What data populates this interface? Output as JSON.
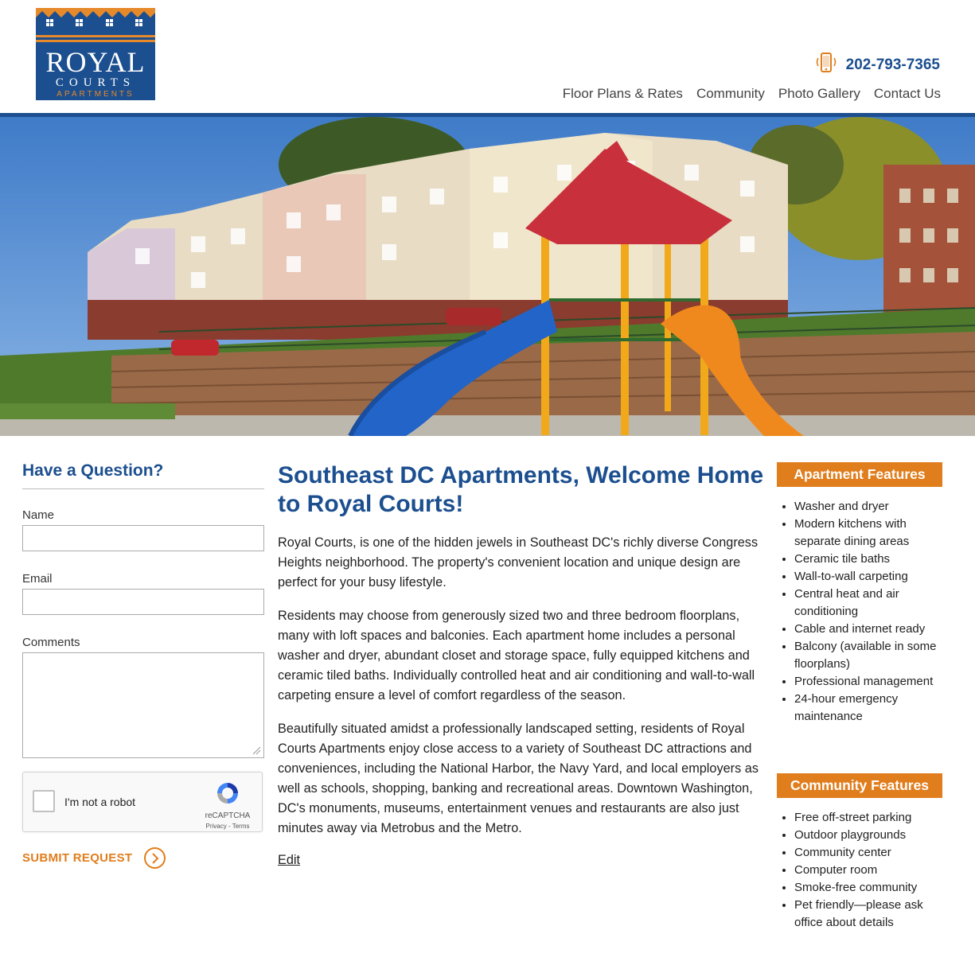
{
  "brand": {
    "line1": "ROYAL",
    "line2": "COURTS",
    "line3": "APARTMENTS",
    "colors": {
      "blue": "#1c4f8f",
      "orange": "#e07d1c"
    }
  },
  "header": {
    "phone_icon": "mobile-phone-icon",
    "phone": "202-793-7365",
    "nav": [
      "Floor Plans & Rates",
      "Community",
      "Photo Gallery",
      "Contact Us"
    ]
  },
  "hero": {
    "slides_total": 3,
    "active_slide": 3
  },
  "form": {
    "title": "Have a Question?",
    "name_label": "Name",
    "email_label": "Email",
    "comments_label": "Comments",
    "captcha_text": "I'm not a robot",
    "captcha_brand": "reCAPTCHA",
    "captcha_terms": "Privacy - Terms",
    "submit_label": "SUBMIT REQUEST"
  },
  "main": {
    "title": "Southeast DC Apartments, Welcome Home to Royal Courts!",
    "paragraphs": [
      "Royal Courts, is one of the hidden jewels in Southeast DC's richly diverse Congress Heights neighborhood. The property's convenient location and unique design are perfect for your busy lifestyle.",
      "Residents may choose from generously sized two and three bedroom floorplans, many with loft spaces and balconies. Each apartment home includes a personal washer and dryer, abundant closet and storage space, fully equipped kitchens and ceramic tiled baths. Individually controlled heat and air conditioning and wall-to-wall carpeting ensure a level of comfort regardless of the season.",
      "Beautifully situated amidst a professionally landscaped setting, residents of Royal Courts Apartments enjoy close access to a variety of Southeast DC attractions and conveniences, including the National Harbor, the Navy Yard, and local employers as well as schools, shopping, banking and recreational areas. Downtown Washington, DC's monuments, museums, entertainment venues and restaurants are also just minutes away via Metrobus and the Metro."
    ],
    "edit_link": "Edit"
  },
  "sidebar": {
    "apartment_title": "Apartment Features",
    "apartment_items": [
      "Washer and dryer",
      "Modern kitchens with separate dining areas",
      "Ceramic tile baths",
      "Wall-to-wall carpeting",
      "Central heat and air conditioning",
      "Cable and internet ready",
      "Balcony (available in some floorplans)",
      "Professional management",
      "24-hour emergency maintenance"
    ],
    "community_title": "Community Features",
    "community_items": [
      "Free off-street parking",
      "Outdoor playgrounds",
      "Community center",
      "Computer room",
      "Smoke-free community",
      "Pet friendly—please ask office about details"
    ]
  }
}
